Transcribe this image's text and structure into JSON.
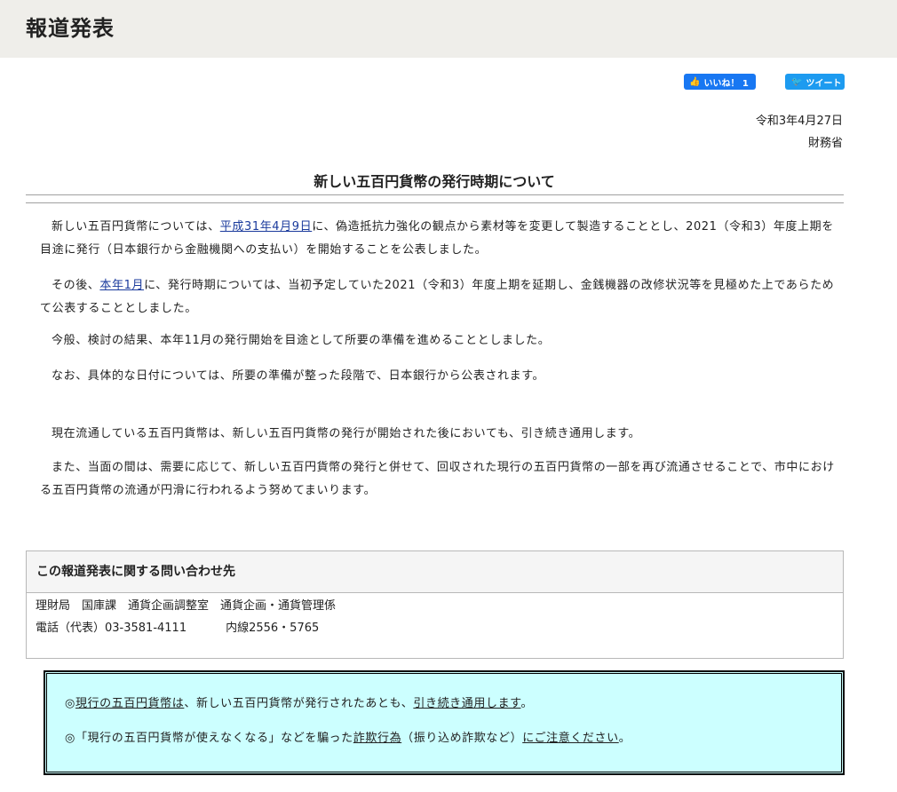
{
  "header": {
    "title": "報道発表"
  },
  "social": {
    "like_icon": "👍",
    "like_label": "いいね！ 1",
    "tweet_icon": "🐦",
    "tweet_label": "ツイート"
  },
  "meta": {
    "date": "令和3年4月27日",
    "ministry": "財務省"
  },
  "document": {
    "title": "新しい五百円貨幣の発行時期について",
    "p1": {
      "before": "新しい五百円貨幣については、",
      "link": "平成31年4月9日",
      "after": "に、偽造抵抗力強化の観点から素材等を変更して製造することとし、2021（令和3）年度上期を目途に発行（日本銀行から金融機関への支払い）を開始することを公表しました。"
    },
    "p2": {
      "before": "その後、",
      "link": "本年1月",
      "after": "に、発行時期については、当初予定していた2021（令和3）年度上期を延期し、金銭機器の改修状況等を見極めた上であらためて公表することとしました。"
    },
    "p3": "今般、検討の結果、本年11月の発行開始を目途として所要の準備を進めることとしました。",
    "p4": "なお、具体的な日付については、所要の準備が整った段階で、日本銀行から公表されます。",
    "p5": "現在流通している五百円貨幣は、新しい五百円貨幣の発行が開始された後においても、引き続き通用します。",
    "p6": "また、当面の間は、需要に応じて、新しい五百円貨幣の発行と併せて、回収された現行の五百円貨幣の一部を再び流通させることで、市中における五百円貨幣の流通が円滑に行われるよう努めてまいります。"
  },
  "contact": {
    "heading": "この報道発表に関する問い合わせ先",
    "department": "理財局　国庫課　通貨企画調整室　通貨企画・通貨管理係",
    "phone": "電話（代表）03-3581-4111",
    "extension": "内線2556・5765"
  },
  "notice": {
    "line1": {
      "mark": "◎",
      "u1": "現行の五百円貨幣は",
      "mid": "、新しい五百円貨幣が発行されたあとも、",
      "u2": "引き続き通用します",
      "end": "。"
    },
    "line2": {
      "mark": "◎",
      "pre": "「現行の五百円貨幣が使えなくなる」などを騙った",
      "u1": "詐欺行為",
      "mid": "（振り込め詐欺など）",
      "u2": "にご注意ください",
      "end": "。"
    }
  }
}
